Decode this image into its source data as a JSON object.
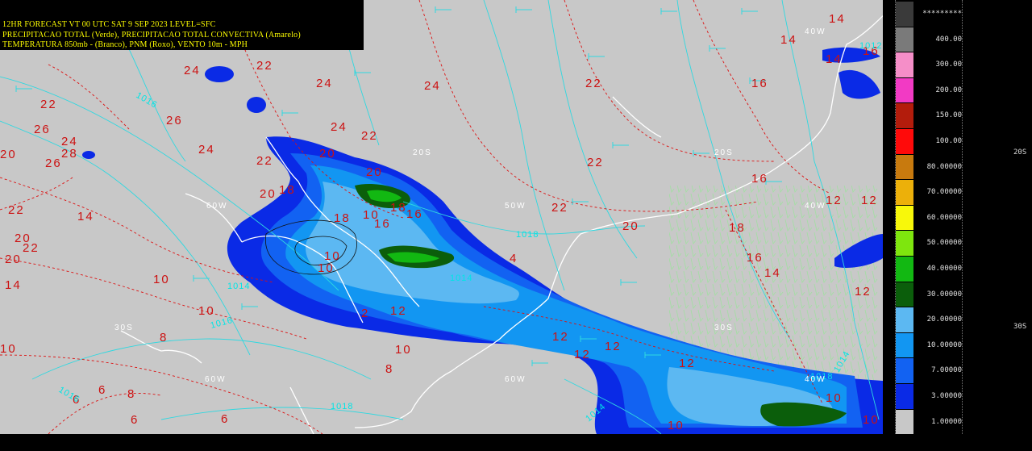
{
  "title": {
    "line1": "12HR FORECAST   VT 00 UTC SAT  9 SEP 2023    LEVEL=SFC",
    "line2": "PRECIPITACAO TOTAL (Verde), PRECIPITACAO TOTAL CONVECTIVA (Amarelo)",
    "line3": "TEMPERATURA 850mb - (Branco), PNM (Roxo), VENTO 10m - MPH"
  },
  "colorbar": {
    "entries": [
      {
        "label": "*********",
        "color": "#3a3a3a"
      },
      {
        "label": "400.00",
        "color": "#7a7a7a"
      },
      {
        "label": "300.00",
        "color": "#f58ec8"
      },
      {
        "label": "200.00",
        "color": "#f23ac4"
      },
      {
        "label": "150.00",
        "color": "#b31c0c"
      },
      {
        "label": "100.00",
        "color": "#ff0a0a"
      },
      {
        "label": "80.00000",
        "color": "#c87a0e"
      },
      {
        "label": "70.00000",
        "color": "#ecb00a"
      },
      {
        "label": "60.00000",
        "color": "#f8f80a"
      },
      {
        "label": "50.00000",
        "color": "#7ee60e"
      },
      {
        "label": "40.00000",
        "color": "#12b812"
      },
      {
        "label": "30.00000",
        "color": "#0b5e0b"
      },
      {
        "label": "20.00000",
        "color": "#5cb8f2"
      },
      {
        "label": "10.00000",
        "color": "#1296f2"
      },
      {
        "label": "7.00000",
        "color": "#1262f2"
      },
      {
        "label": "3.00000",
        "color": "#0a2ae6"
      },
      {
        "label": "1.00000",
        "color": "#c8c8c8"
      }
    ]
  },
  "lat_labels": {
    "upper": "20S",
    "lower": "30S"
  },
  "map_labels": {
    "temperature": [
      "24",
      "22",
      "24",
      "24",
      "22",
      "16",
      "14",
      "14",
      "14",
      "26",
      "22",
      "24",
      "22",
      "20",
      "22",
      "24",
      "22",
      "16",
      "26",
      "28",
      "24",
      "26",
      "18",
      "20",
      "18",
      "16",
      "16",
      "20",
      "18",
      "10",
      "16",
      "20",
      "22",
      "22",
      "18",
      "12",
      "12",
      "16",
      "14",
      "14",
      "12",
      "10",
      "10",
      "10",
      "10",
      "8",
      "12",
      "10",
      "8",
      "10",
      "12",
      "12",
      "12",
      "12",
      "10",
      "8",
      "6",
      "6",
      "6",
      "6",
      "10",
      "10",
      "14",
      "2",
      "4",
      "20",
      "20",
      "22",
      "20"
    ],
    "pressure": [
      "1016",
      "1018",
      "1016",
      "1014",
      "1014",
      "1016",
      "1018",
      "1014",
      "1014",
      "1018",
      "1012"
    ],
    "longitude": [
      "60W",
      "60W",
      "50W",
      "40W",
      "40W",
      "20S",
      "20S",
      "30S",
      "30S",
      "40W",
      "60W"
    ]
  }
}
